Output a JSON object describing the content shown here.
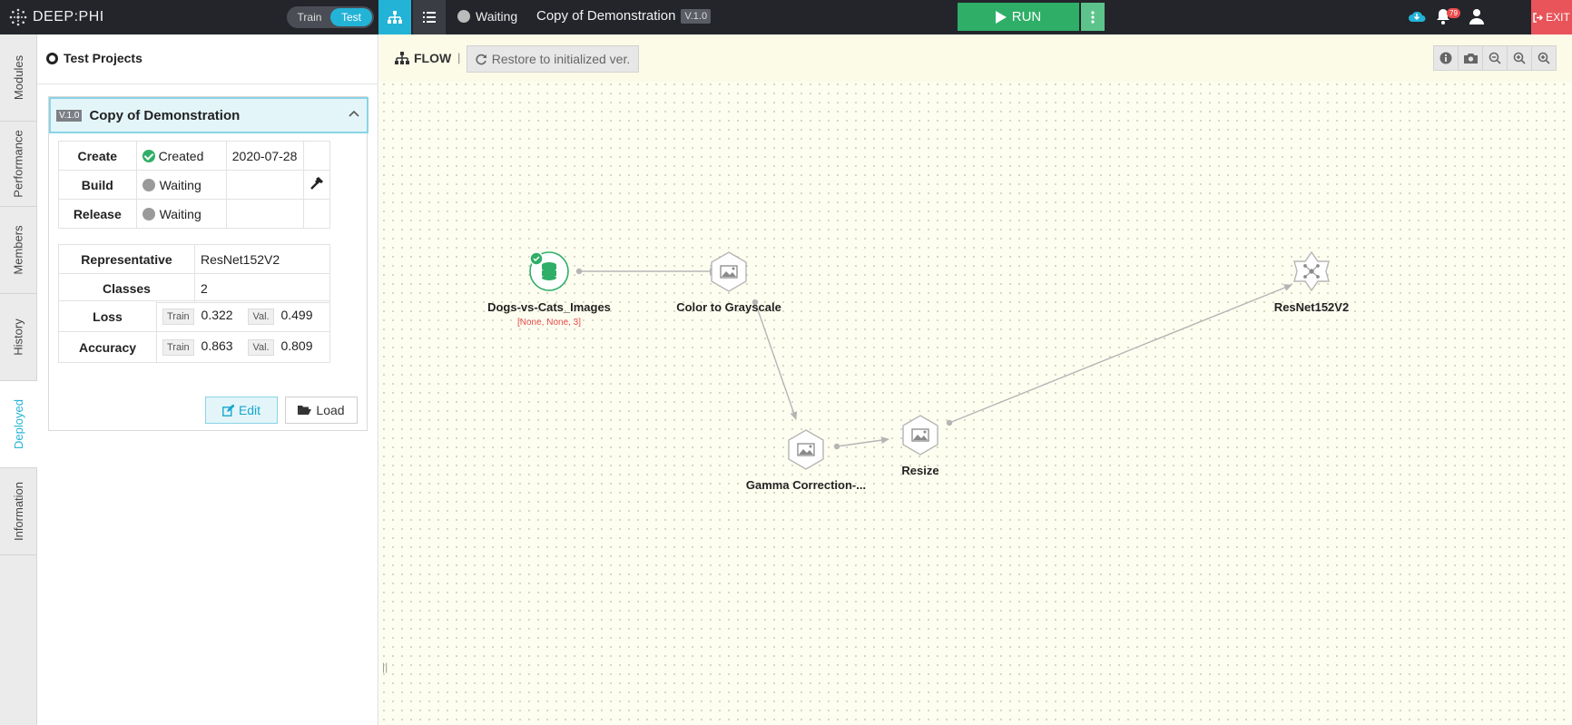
{
  "app": {
    "logo_text": "DEEP:PHI",
    "mode_train": "Train",
    "mode_test": "Test",
    "status": "Waiting",
    "project_title": "Copy of Demonstration",
    "version": "V.1.0",
    "run_label": "RUN",
    "notification_count": "79",
    "exit_label": "EXIT"
  },
  "vtabs": [
    "Modules",
    "Performance",
    "Members",
    "History",
    "Deployed",
    "Information"
  ],
  "active_tab": "Deployed",
  "panel": {
    "heading": "Test Projects",
    "card": {
      "version": "V.1.0",
      "title": "Copy of Demonstration",
      "stages": [
        {
          "label": "Create",
          "status": "Created",
          "date": "2020-07-28"
        },
        {
          "label": "Build",
          "status": "Waiting",
          "date": ""
        },
        {
          "label": "Release",
          "status": "Waiting",
          "date": ""
        }
      ],
      "info": [
        {
          "label": "Representative",
          "value": "ResNet152V2"
        },
        {
          "label": "Classes",
          "value": "2"
        }
      ],
      "metrics": [
        {
          "label": "Loss",
          "train_tag": "Train",
          "train": "0.322",
          "val_tag": "Val.",
          "val": "0.499"
        },
        {
          "label": "Accuracy",
          "train_tag": "Train",
          "train": "0.863",
          "val_tag": "Val.",
          "val": "0.809"
        }
      ],
      "edit_label": "Edit",
      "load_label": "Load"
    }
  },
  "canvas": {
    "flow_label": "FLOW",
    "restore_label": "Restore to initialized ver.",
    "nodes": [
      {
        "id": "dataset",
        "label": "Dogs-vs-Cats_Images",
        "sub": "[None, None, 3]",
        "icon": "database-icon"
      },
      {
        "id": "grayscale",
        "label": "Color to Grayscale",
        "icon": "image-icon"
      },
      {
        "id": "gamma",
        "label": "Gamma Correction-...",
        "icon": "image-icon"
      },
      {
        "id": "resize",
        "label": "Resize",
        "icon": "image-icon"
      },
      {
        "id": "resnet",
        "label": "ResNet152V2",
        "icon": "network-icon"
      }
    ]
  },
  "colors": {
    "accent": "#23b3d7",
    "run": "#2fae67",
    "exit": "#e8545a",
    "topbar": "#23252b"
  }
}
